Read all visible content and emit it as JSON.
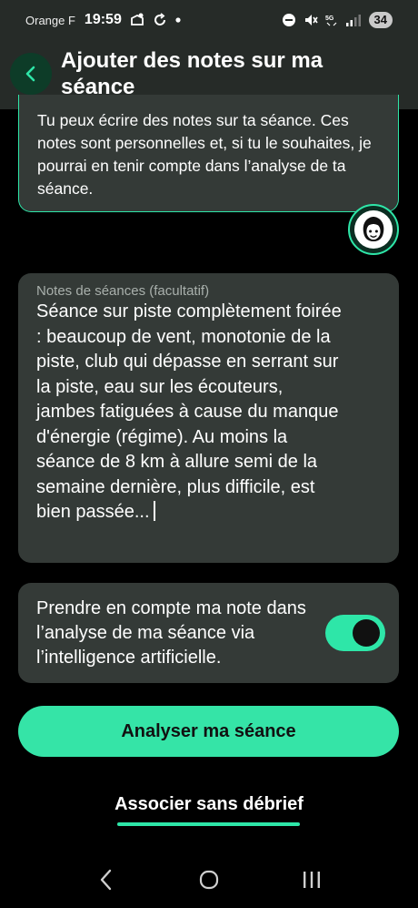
{
  "status_bar": {
    "carrier": "Orange F",
    "time": "19:59",
    "battery": "34"
  },
  "header": {
    "title": "Ajouter des notes sur ma séance"
  },
  "intro": {
    "text": "Tu peux écrire des notes sur ta séance. Ces notes sont personnelles et, si tu le souhaites, je pourrai en tenir compte dans l’analyse de ta séance."
  },
  "notes": {
    "label": "Notes de séances (facultatif)",
    "value": "Séance sur piste complètement foirée : beaucoup de vent, monotonie de la piste, club qui dépasse en serrant sur la piste, eau sur les écouteurs, jambes fatiguées à cause du manque d'énergie (régime). Au moins la séance de 8 km à allure semi de la semaine dernière, plus difficile, est bien passée..."
  },
  "ai_toggle": {
    "label": "Prendre en compte ma note dans l’analyse de ma séance via l’intelligence artificielle.",
    "enabled": true
  },
  "actions": {
    "primary_label": "Analyser ma séance",
    "secondary_label": "Associer sans débrief"
  },
  "colors": {
    "accent": "#2ee6a8",
    "card": "#343a37",
    "header": "#262b28",
    "background": "#000000"
  },
  "icons": {
    "back": "chevron-left-icon",
    "avatar": "coach-avatar-icon",
    "nav_back": "nav-back-icon",
    "nav_home": "nav-home-icon",
    "nav_recent": "nav-recent-apps-icon"
  }
}
